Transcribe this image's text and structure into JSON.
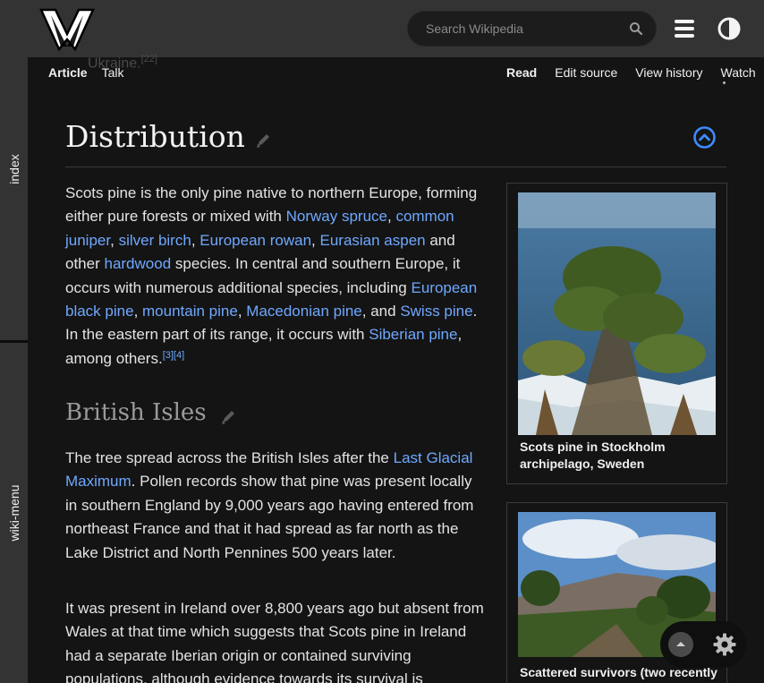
{
  "header": {
    "search_placeholder": "Search Wikipedia"
  },
  "rails": {
    "top_label": "index",
    "bottom_label": "wiki-menu"
  },
  "ghost_text": "Ukraine.",
  "ghost_ref": "[22]",
  "tabs": {
    "left": [
      {
        "label": "Article",
        "active": true
      },
      {
        "label": "Talk",
        "active": false
      }
    ],
    "right": [
      {
        "label": "Read",
        "active": true
      },
      {
        "label": "Edit source",
        "active": false
      },
      {
        "label": "View history",
        "active": false
      },
      {
        "label": "Watch",
        "active": false
      }
    ]
  },
  "section": {
    "title": "Distribution",
    "para1": {
      "t1": "Scots pine is the only pine native to northern Europe, forming either pure forests or mixed with ",
      "l1": "Norway spruce",
      "t2": ", ",
      "l2": "common juniper",
      "t3": ", ",
      "l3": "silver birch",
      "t4": ", ",
      "l4": "European rowan",
      "t5": ", ",
      "l5": "Eurasian aspen",
      "t6": " and other ",
      "l6": "hardwood",
      "t7": " species. In central and southern Europe, it occurs with numerous additional species, including ",
      "l7": "European black pine",
      "t8": ", ",
      "l8": "mountain pine",
      "t9": ", ",
      "l9": "Macedonian pine",
      "t10": ", and ",
      "l10": "Swiss pine",
      "t11": ". In the eastern part of its range, it occurs with ",
      "l11": "Siberian pine",
      "t12": ", among others.",
      "r1": "[3]",
      "r2": "[4]"
    }
  },
  "subsection": {
    "title": "British Isles",
    "para1": {
      "t1": "The tree spread across the British Isles after the ",
      "l1": "Last Glacial Maximum",
      "t2": ". Pollen records show that pine was present locally in southern England by 9,000 years ago having entered from northeast France and that it had spread as far north as the Lake District and North Pennines 500 years later."
    },
    "para2": "It was present in Ireland over 8,800 years ago but absent from Wales at that time which suggests that Scots pine in Ireland had a separate Iberian origin or contained surviving populations, although evidence towards its survival is"
  },
  "figures": [
    {
      "caption": "Scots pine in Stockholm archipelago, Sweden"
    },
    {
      "caption": "Scattered survivors (two recently"
    }
  ],
  "colors": {
    "link": "#6fa8ff",
    "accent_blue": "#3d8bff"
  }
}
